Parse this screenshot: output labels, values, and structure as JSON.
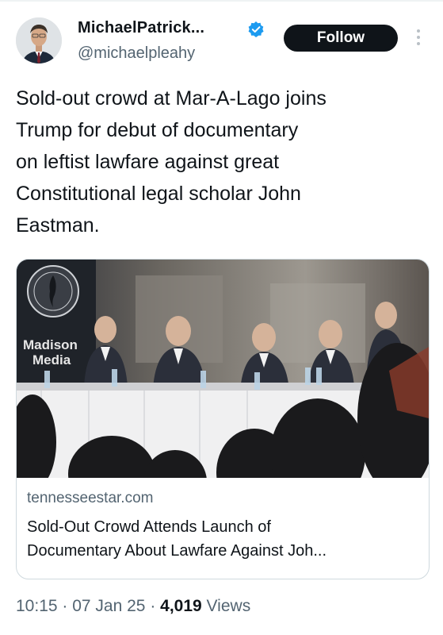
{
  "author": {
    "display_name": "MichaelPatrick...",
    "handle": "@michaelpleahy",
    "verified_icon": "verified-badge-icon"
  },
  "follow_label": "Follow",
  "tweet": {
    "text": "Sold-out crowd at Mar-A-Lago joins\nTrump for debut of documentary\non leftist lawfare against great\nConstitutional legal scholar John\nEastman."
  },
  "link_card": {
    "image_banner_line1": "Madison",
    "image_banner_line2": "Media",
    "domain": "tennesseestar.com",
    "title_line1": "Sold-Out Crowd Attends Launch of",
    "title_line2": "Documentary About Lawfare Against Joh..."
  },
  "meta": {
    "time": "10:15",
    "sep1": " · ",
    "date": "07 Jan 25",
    "sep2": " · ",
    "views_count": "4,019",
    "views_label": " Views"
  },
  "colors": {
    "text_primary": "#0f1419",
    "text_secondary": "#536471",
    "verified_blue": "#1d9bf0",
    "border": "#cfd9de"
  }
}
